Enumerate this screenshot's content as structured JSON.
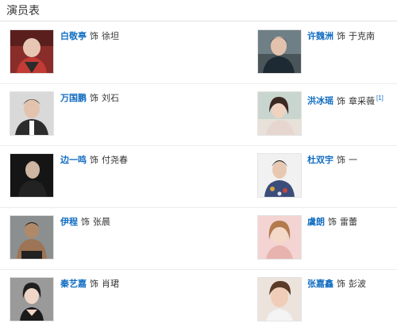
{
  "header": {
    "title": "演员表"
  },
  "cast": [
    {
      "actor": "白敬亭",
      "sep": "饰",
      "role": "徐坦",
      "cite": ""
    },
    {
      "actor": "许魏洲",
      "sep": "饰",
      "role": "于克南",
      "cite": ""
    },
    {
      "actor": "万国鹏",
      "sep": "饰",
      "role": "刘石",
      "cite": ""
    },
    {
      "actor": "洪冰瑶",
      "sep": "饰",
      "role": "章采薇",
      "cite": "[1]"
    },
    {
      "actor": "边一鸣",
      "sep": "饰",
      "role": "付尧春",
      "cite": ""
    },
    {
      "actor": "杜双宇",
      "sep": "饰",
      "role": "一",
      "cite": ""
    },
    {
      "actor": "伊程",
      "sep": "饰",
      "role": "张晨",
      "cite": ""
    },
    {
      "actor": "虞朗",
      "sep": "饰",
      "role": "雷蕾",
      "cite": ""
    },
    {
      "actor": "秦艺嘉",
      "sep": "饰",
      "role": "肖珺",
      "cite": ""
    },
    {
      "actor": "张嘉鑫",
      "sep": "饰",
      "role": "彭波",
      "cite": ""
    }
  ],
  "colors": {
    "link": "#136ec2",
    "text": "#333333",
    "divider": "#ececec"
  }
}
